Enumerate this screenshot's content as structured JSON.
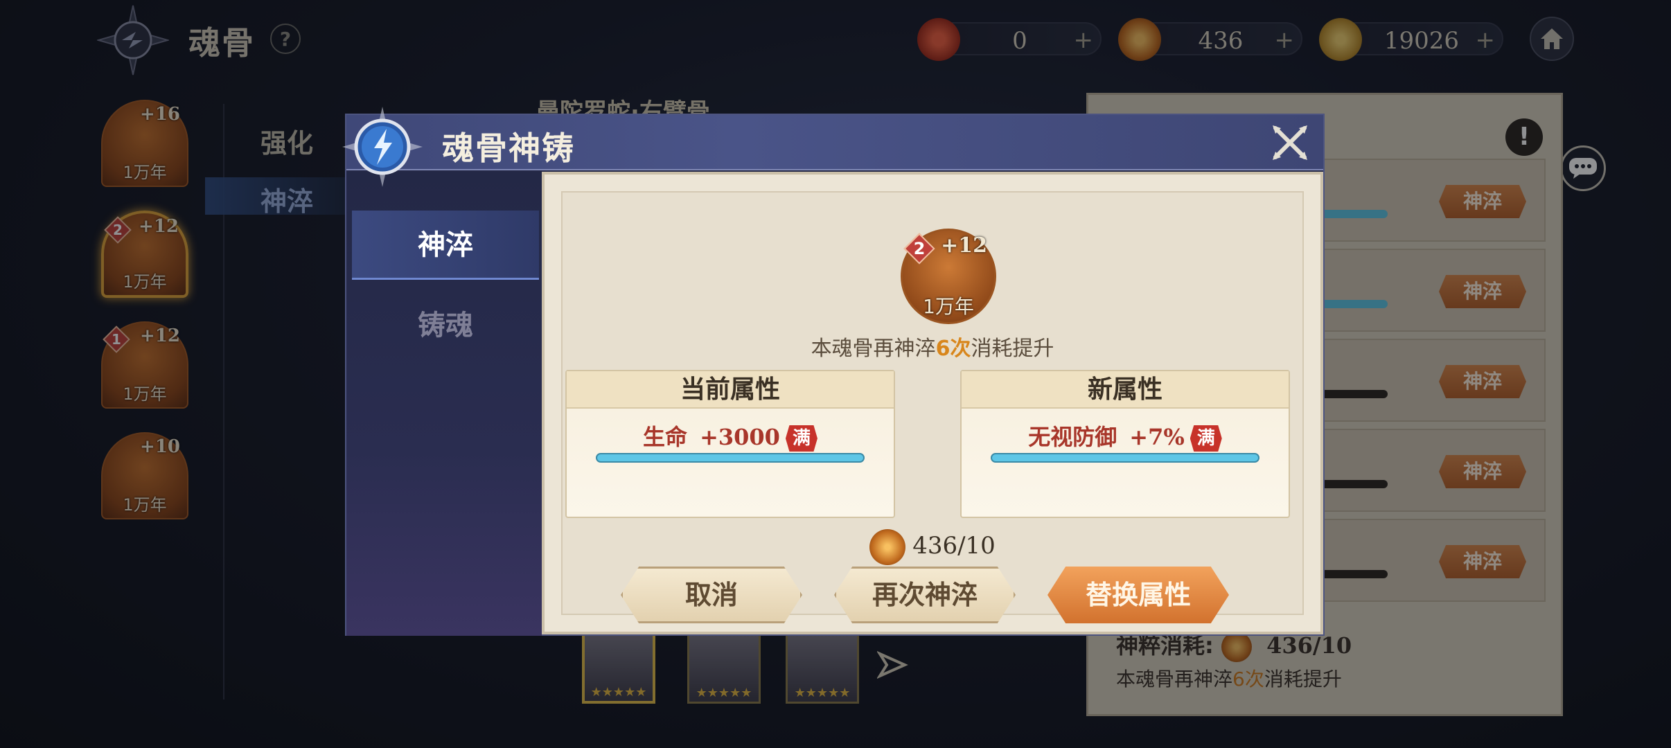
{
  "header": {
    "title": "魂骨",
    "help": "?"
  },
  "currencies": [
    {
      "name": "red-gem",
      "value": "0",
      "plus": "+"
    },
    {
      "name": "soul-coin",
      "value": "436",
      "plus": "+"
    },
    {
      "name": "gold",
      "value": "19026",
      "plus": "+"
    }
  ],
  "bones": [
    {
      "level": "+16",
      "age": "1万年",
      "rank": ""
    },
    {
      "level": "+12",
      "age": "1万年",
      "rank": "2"
    },
    {
      "level": "+12",
      "age": "1万年",
      "rank": "1"
    },
    {
      "level": "+10",
      "age": "1万年",
      "rank": ""
    }
  ],
  "side_menu": {
    "items": [
      {
        "label": "强化"
      },
      {
        "label": "神淬"
      }
    ]
  },
  "right_panel": {
    "info": "!",
    "rows": [
      {
        "button": "神淬"
      },
      {
        "button": "神淬"
      },
      {
        "button": "神淬"
      },
      {
        "button": "神淬"
      },
      {
        "button": "神淬"
      }
    ],
    "cost_label": "神粹消耗:",
    "cost_value": "436/10",
    "note_prefix": "本魂骨再神淬",
    "note_times": "6次",
    "note_suffix": "消耗提升"
  },
  "background_title": "曼陀罗蛇·右臂骨",
  "dialog": {
    "title": "魂骨神铸",
    "tabs": [
      {
        "label": "神淬"
      },
      {
        "label": "铸魂"
      }
    ],
    "bone": {
      "level": "+12",
      "age": "1万年",
      "rank": "2"
    },
    "note_prefix": "本魂骨再神淬",
    "note_times": "6次",
    "note_suffix": "消耗提升",
    "current": {
      "header": "当前属性",
      "attr": "生命",
      "value": "+3000",
      "badge": "满"
    },
    "new": {
      "header": "新属性",
      "attr": "无视防御",
      "value": "+7%",
      "badge": "满"
    },
    "cost": "436/10",
    "buttons": {
      "cancel": "取消",
      "reroll": "再次神淬",
      "replace": "替换属性"
    }
  },
  "colors": {
    "accent_orange": "#d8861c",
    "max_badge": "#c7322a",
    "bar_blue": "#5ec6e6"
  }
}
